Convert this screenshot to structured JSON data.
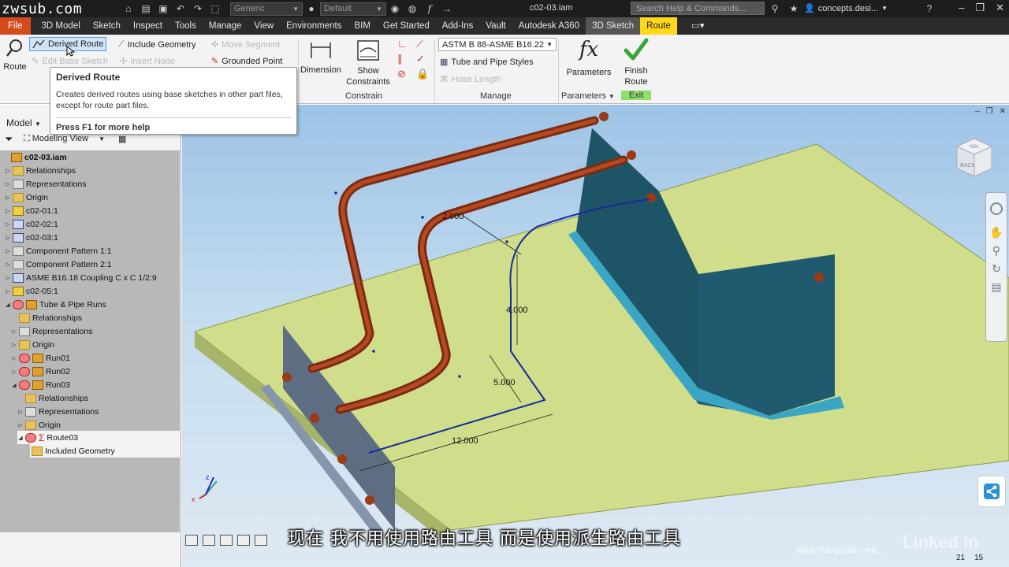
{
  "titlebar": {
    "logo": "zwsub.com",
    "material_combo": "Generic",
    "appearance_combo": "Default",
    "doc_title": "c02-03.iam",
    "search_placeholder": "Search Help & Commands...",
    "account": "concepts.desi..."
  },
  "tabs": [
    "File",
    "3D Model",
    "Sketch",
    "Inspect",
    "Tools",
    "Manage",
    "View",
    "Environments",
    "BIM",
    "Get Started",
    "Add-Ins",
    "Vault",
    "Autodesk A360",
    "3D Sketch",
    "Route"
  ],
  "ribbon": {
    "route_label": "Route",
    "derived_route": "Derived Route",
    "include_geometry": "Include Geometry",
    "move_segment": "Move Segment",
    "edit_base_sketch": "Edit Base Sketch",
    "insert_node": "Insert Node",
    "grounded_point": "Grounded Point",
    "dimension": "Dimension",
    "show_constraints": "Show Constraints",
    "constrain_label": "Constrain",
    "style_combo": "ASTM B 88-ASME B16.22",
    "tube_pipe_styles": "Tube and Pipe Styles",
    "hose_length": "Hose Length",
    "manage_label": "Manage",
    "parameters": "Parameters",
    "parameters_panel": "Parameters",
    "finish_route": "Finish Route",
    "exit_label": "Exit"
  },
  "tooltip": {
    "title": "Derived Route",
    "description": "Creates derived routes using base sketches in other part files, except for route part files.",
    "help": "Press F1 for more help"
  },
  "browser": {
    "model_label": "Model",
    "view_label": "Modeling View",
    "nodes": [
      {
        "label": "c02-03.iam"
      },
      {
        "label": "Relationships"
      },
      {
        "label": "Representations"
      },
      {
        "label": "Origin"
      },
      {
        "label": "c02-01:1"
      },
      {
        "label": "c02-02:1"
      },
      {
        "label": "c02-03:1"
      },
      {
        "label": "Component Pattern 1:1"
      },
      {
        "label": "Component Pattern 2:1"
      },
      {
        "label": "ASME B16.18 Coupling C x C 1/2:9"
      },
      {
        "label": "c02-05:1"
      },
      {
        "label": "Tube & Pipe Runs"
      },
      {
        "label": "Relationships"
      },
      {
        "label": "Representations"
      },
      {
        "label": "Origin"
      },
      {
        "label": "Run01"
      },
      {
        "label": "Run02"
      },
      {
        "label": "Run03"
      },
      {
        "label": "Relationships"
      },
      {
        "label": "Representations"
      },
      {
        "label": "Origin"
      },
      {
        "label": "Route03"
      },
      {
        "label": "Included Geometry"
      }
    ]
  },
  "viewport": {
    "dim_12": "12.000",
    "dim_5": "5.000",
    "dim_4": "4.000",
    "dim_radius": "2.000",
    "viewcube_top": "NDL",
    "viewcube_face": "BACK",
    "subtitle": "现在 我不用使用路由工具 而是使用派生路由工具",
    "watermark": "https://blog.csdn.net/...",
    "brand": "Linked in",
    "page_left": "21",
    "page_right": "15"
  }
}
